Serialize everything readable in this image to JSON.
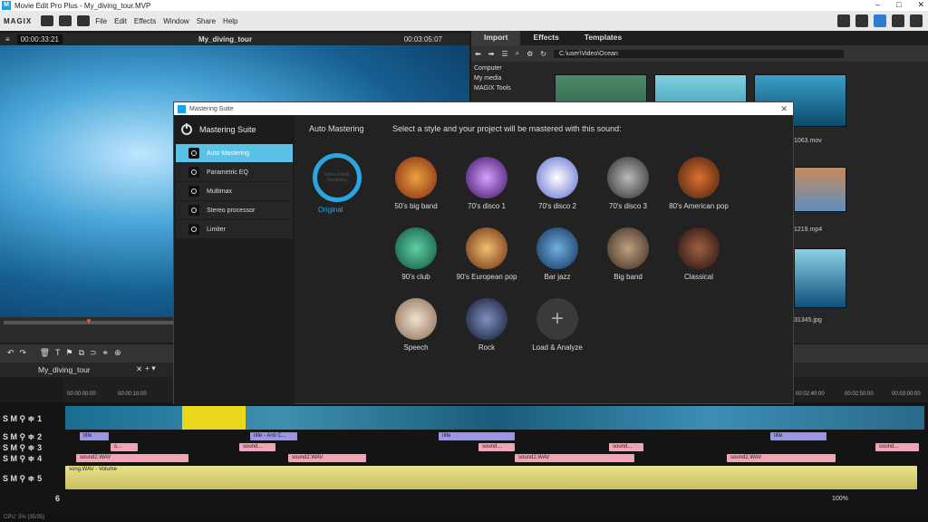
{
  "window": {
    "title": "Movie Edit Pro Plus - My_diving_tour.MVP",
    "logo": "M"
  },
  "menu": {
    "brand": "MAGIX",
    "items": [
      "File",
      "Edit",
      "Effects",
      "Window",
      "Share",
      "Help"
    ]
  },
  "preview": {
    "timecode_left": "00:00:33:21",
    "title": "My_diving_tour",
    "timecode_right": "00:03:05:07"
  },
  "media": {
    "tabs": [
      "Import",
      "Effects",
      "Templates"
    ],
    "path": "C:\\user\\Video\\Ocean",
    "tree": [
      "Computer",
      "My media",
      "MAGIX Tools"
    ],
    "thumb_labels": [
      "1063.mov",
      "1219.mp4",
      "31345.jpg"
    ]
  },
  "timeline": {
    "project_tab": "My_diving_tour",
    "ruler": [
      "00:00:00:00",
      "00:00:10:00",
      "00:02:40:00",
      "00:02:50:00",
      "00:03:00:00"
    ],
    "track_numbers": [
      "1",
      "2",
      "3",
      "4",
      "5",
      "6"
    ],
    "clip_labels": {
      "title": "title",
      "title_anti": "title - Anti C...",
      "sound2": "sound2.WAV",
      "sound_short": "sound...",
      "s_short": "s...",
      "song": "song.WAV - Volume"
    },
    "zoom": "100%"
  },
  "status": "CPU: 3% (35/35)",
  "dialog": {
    "title": "Mastering Suite",
    "side_header": "Mastering Suite",
    "side_items": [
      "Auto Mastering",
      "Parametric EQ",
      "Multimax",
      "Stereo processor",
      "Limiter"
    ],
    "section": "Auto Mastering",
    "instruction": "Select a style and your project will be mastered with this sound:",
    "original_circle": "without Auto Mastering",
    "original_label": "Original",
    "styles": [
      "50's big band",
      "70's disco 1",
      "70's disco 2",
      "70's disco 3",
      "80's American pop",
      "90's club",
      "90's European pop",
      "Bar jazz",
      "Big band",
      "Classical",
      "Speech",
      "Rock",
      "Load & Analyze"
    ]
  },
  "colors": {
    "accent": "#5bc2e7",
    "blue": "#2aa7e0",
    "title_clip": "#9b95e8",
    "audio_clip": "#f2a3b4",
    "volume_track": "#e9e28c"
  }
}
